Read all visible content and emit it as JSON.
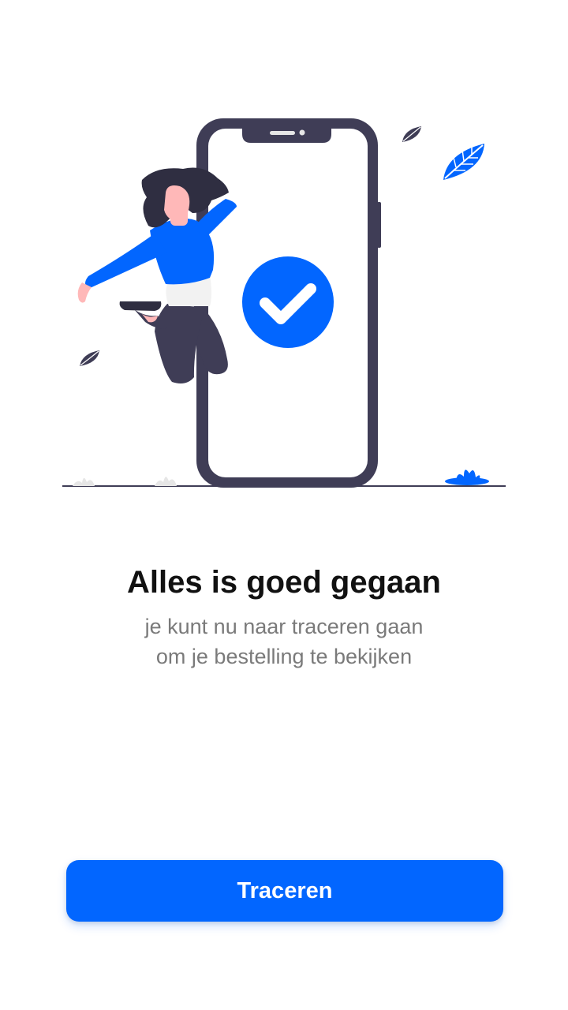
{
  "screen": {
    "title": "Alles is goed gegaan",
    "subtitle_lines": [
      "je kunt nu naar traceren gaan",
      "om je bestelling te bekijken"
    ],
    "primary_button": {
      "label": "Traceren"
    }
  },
  "colors": {
    "accent": "#0266ff",
    "dark": "#3f3d56",
    "skin": "#ffb8b8",
    "hair": "#2f2e41"
  },
  "icons": {
    "success": "checkmark-circle-icon"
  }
}
